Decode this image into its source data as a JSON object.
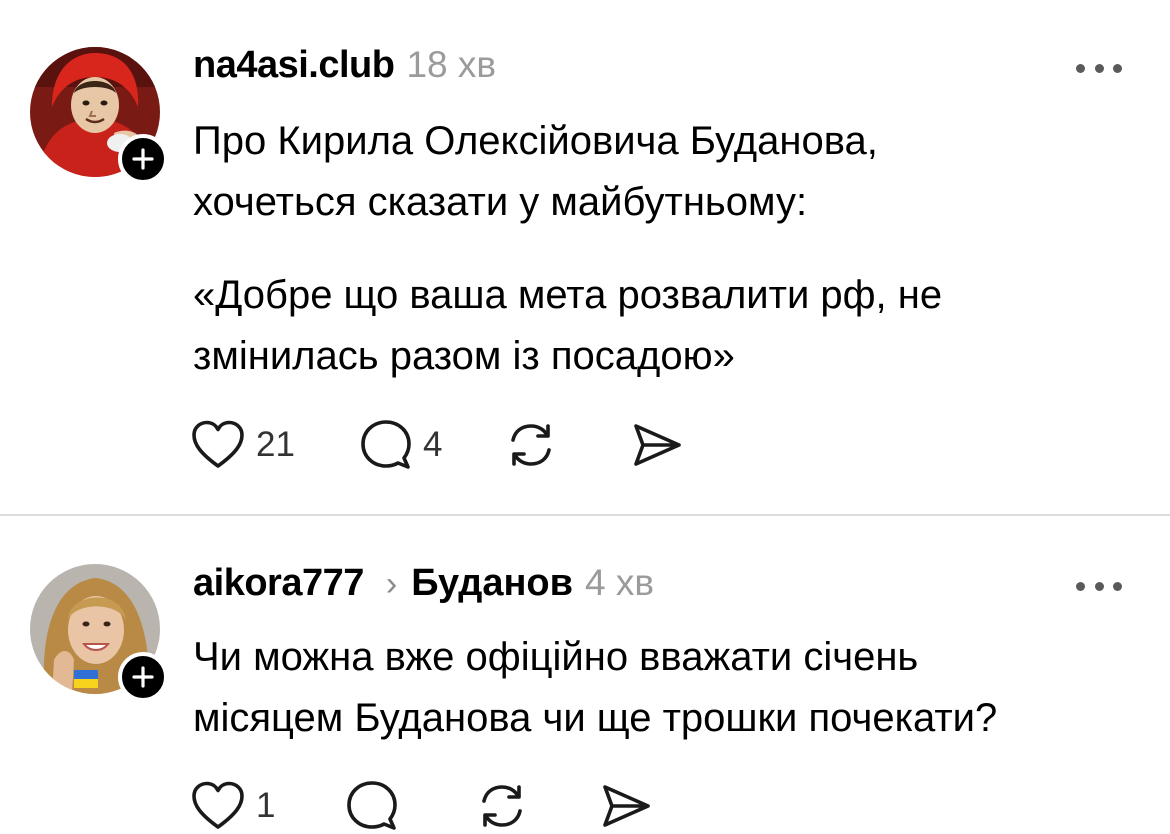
{
  "posts": [
    {
      "username": "na4asi.club",
      "time": "18 хв",
      "topic": "",
      "paragraphs": [
        "Про Кирила Олексійовича Буданова,",
        "хочеться сказати у майбутньому:",
        "«Добре що ваша мета розвалити рф, не",
        "змінилась разом із посадою»"
      ],
      "likes": "21",
      "replies": "4",
      "reposts": "",
      "shares": ""
    },
    {
      "username": "aikora777",
      "time": "4 хв",
      "topic": "Буданов",
      "paragraphs": [
        "Чи можна вже офіційно вважати січень",
        "місяцем Буданова чи ще трошки почекати?"
      ],
      "likes": "1",
      "replies": "",
      "reposts": "",
      "shares": ""
    }
  ],
  "icons": {
    "follow": "plus-icon",
    "more": "more-horizontal-icon",
    "like": "heart-icon",
    "reply": "comment-icon",
    "repost": "repost-icon",
    "share": "send-icon",
    "chevron": "chevron-right-icon"
  },
  "colors": {
    "text": "#000000",
    "muted": "#9b9b9b",
    "divider": "#dcdcdc",
    "icon": "#1a1a1a"
  }
}
